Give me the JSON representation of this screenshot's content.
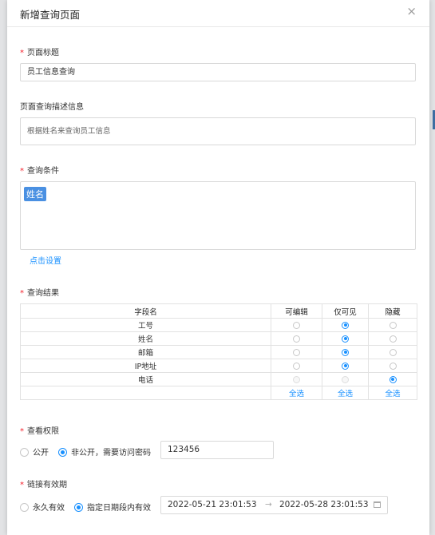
{
  "dialog": {
    "title": "新增查询页面",
    "close_icon": "×"
  },
  "page_title": {
    "label": "页面标题",
    "value": "员工信息查询"
  },
  "page_desc": {
    "label": "页面查询描述信息",
    "value": "根据姓名来查询员工信息"
  },
  "query_condition": {
    "label": "查询条件",
    "tag": "姓名",
    "setting_link": "点击设置"
  },
  "query_result": {
    "label": "查询结果",
    "columns": [
      "字段名",
      "可编辑",
      "仅可见",
      "隐藏"
    ],
    "rows": [
      {
        "field": "工号",
        "selected": "visible"
      },
      {
        "field": "姓名",
        "selected": "visible"
      },
      {
        "field": "邮箱",
        "selected": "visible"
      },
      {
        "field": "IP地址",
        "selected": "visible"
      },
      {
        "field": "电话",
        "selected": "hidden"
      }
    ],
    "select_all": [
      "全选",
      "全选",
      "全选"
    ]
  },
  "permission": {
    "label": "查看权限",
    "public_label": "公开",
    "private_label": "非公开，需要访问密码",
    "selected": "private",
    "password": "123456"
  },
  "link_validity": {
    "label": "链接有效期",
    "forever_label": "永久有效",
    "range_label": "指定日期段内有效",
    "selected": "range",
    "start": "2022-05-21 23:01:53",
    "separator": "→",
    "end": "2022-05-28 23:01:53"
  },
  "colors": {
    "primary": "#1890ff",
    "required": "#f5222d",
    "tag": "#4a90e2"
  }
}
